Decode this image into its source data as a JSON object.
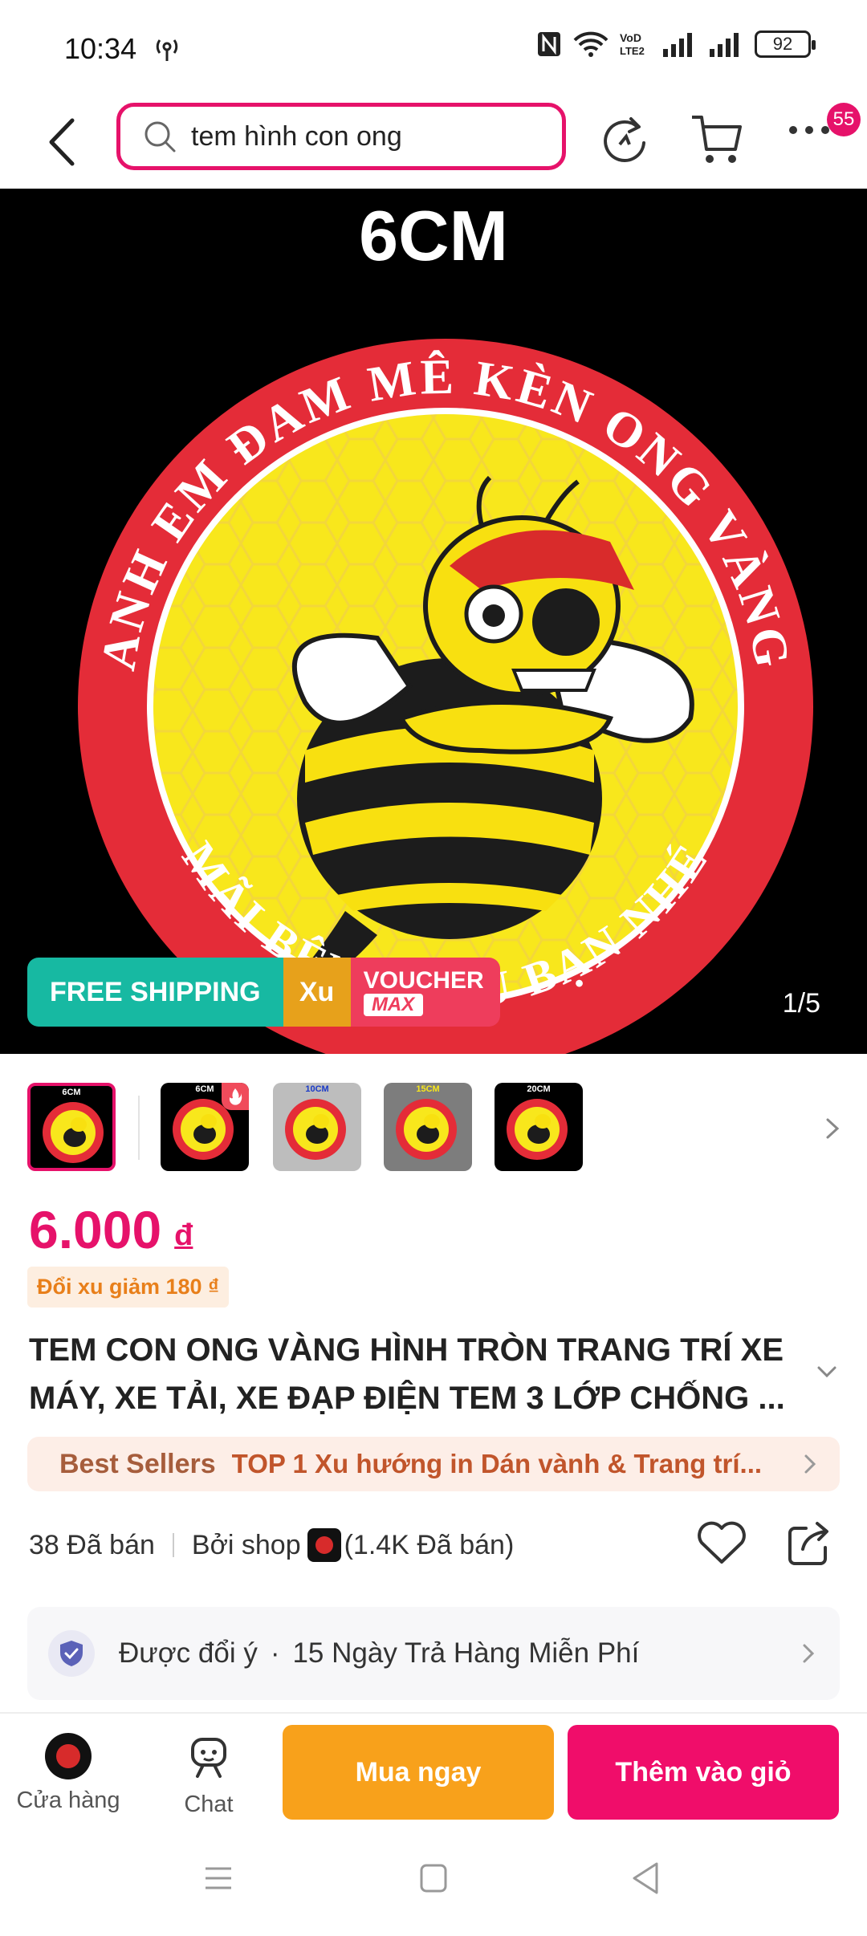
{
  "status_bar": {
    "time": "10:34",
    "battery": "92"
  },
  "search": {
    "query": "tem hình con ong"
  },
  "cart_badge": "55",
  "product_image": {
    "size_label": "6CM",
    "page_indicator": "1/5",
    "shipping_banner": {
      "free_shipping": "FREE SHIPPING",
      "xu": "Xu",
      "voucher": "VOUCHER",
      "max": "MAX"
    }
  },
  "thumbnails": [
    {
      "label": "6CM",
      "bg": "#000000"
    },
    {
      "label": "6CM",
      "bg": "#000000"
    },
    {
      "label": "10CM",
      "bg": "#bdbdbd"
    },
    {
      "label": "15CM",
      "bg": "#7d7d7d"
    },
    {
      "label": "20CM",
      "bg": "#000000"
    }
  ],
  "price": {
    "amount": "6.000",
    "currency": "đ",
    "coin_offer": "Đổi xu giảm 180 ₫"
  },
  "title": "TEM CON ONG VÀNG HÌNH TRÒN TRANG TRÍ XE MÁY, XE TẢI, XE ĐẠP ĐIỆN TEM 3 LỚP CHỐNG ...",
  "best_seller": {
    "label": "Best Sellers",
    "text": "TOP 1 Xu hướng in Dán vành & Trang trí..."
  },
  "sales": {
    "sold": "38 Đã bán",
    "by_shop": "Bởi shop",
    "shop_sold": "(1.4K Đã bán)"
  },
  "return_policy": {
    "label": "Được đổi ý",
    "separator": "·",
    "detail": "15 Ngày Trả Hàng Miễn Phí"
  },
  "actions": {
    "store": "Cửa hàng",
    "chat": "Chat",
    "buy_now": "Mua ngay",
    "add_to_cart": "Thêm vào giỏ"
  },
  "colors": {
    "accent": "#e6126a",
    "buy": "#f8a11b",
    "cart": "#f00d6a",
    "shipping": "#17b9a2"
  }
}
